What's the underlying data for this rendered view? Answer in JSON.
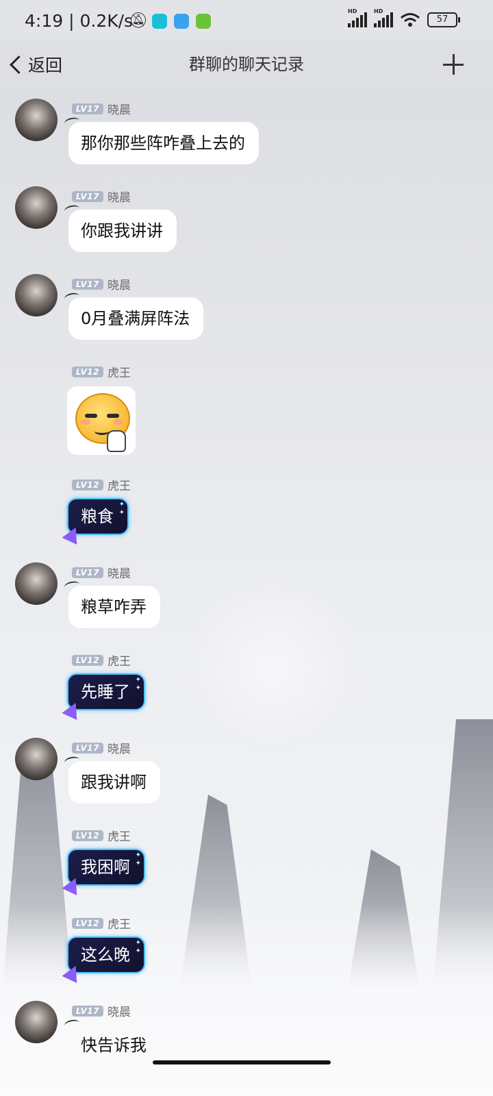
{
  "status_bar": {
    "time": "4:19",
    "net_speed": "0.2K/s",
    "battery": "57",
    "icons": [
      "mute-bell-icon",
      "taptap-app-icon",
      "store-app-icon",
      "download-app-icon",
      "hd-signal-icon",
      "hd-signal-icon",
      "wifi-icon",
      "battery-icon"
    ]
  },
  "header": {
    "back_label": "返回",
    "title": "群聊的聊天记录",
    "add_icon": "plus-icon"
  },
  "messages": [
    {
      "sender": "晓晨",
      "level": "LV17",
      "type": "text",
      "text": "那你那些阵咋叠上去的"
    },
    {
      "sender": "晓晨",
      "level": "LV17",
      "type": "text",
      "text": "你跟我讲讲"
    },
    {
      "sender": "晓晨",
      "level": "LV17",
      "type": "text",
      "text": "0月叠满屏阵法"
    },
    {
      "sender": "虎王",
      "level": "LV12",
      "type": "sticker",
      "text": ""
    },
    {
      "sender": "虎王",
      "level": "LV12",
      "type": "styled",
      "text": "粮食"
    },
    {
      "sender": "晓晨",
      "level": "LV17",
      "type": "text",
      "text": "粮草咋弄"
    },
    {
      "sender": "虎王",
      "level": "LV12",
      "type": "styled",
      "text": "先睡了"
    },
    {
      "sender": "晓晨",
      "level": "LV17",
      "type": "text",
      "text": "跟我讲啊"
    },
    {
      "sender": "虎王",
      "level": "LV12",
      "type": "styled",
      "text": "我困啊"
    },
    {
      "sender": "虎王",
      "level": "LV12",
      "type": "styled",
      "text": "这么晚"
    },
    {
      "sender": "晓晨",
      "level": "LV17",
      "type": "text",
      "text": "快告诉我"
    }
  ],
  "colors": {
    "level_badge": "#aeb7c8",
    "styled_bubble_border": "#4fc0ff",
    "styled_bubble_bg": "#1c1d4a"
  }
}
